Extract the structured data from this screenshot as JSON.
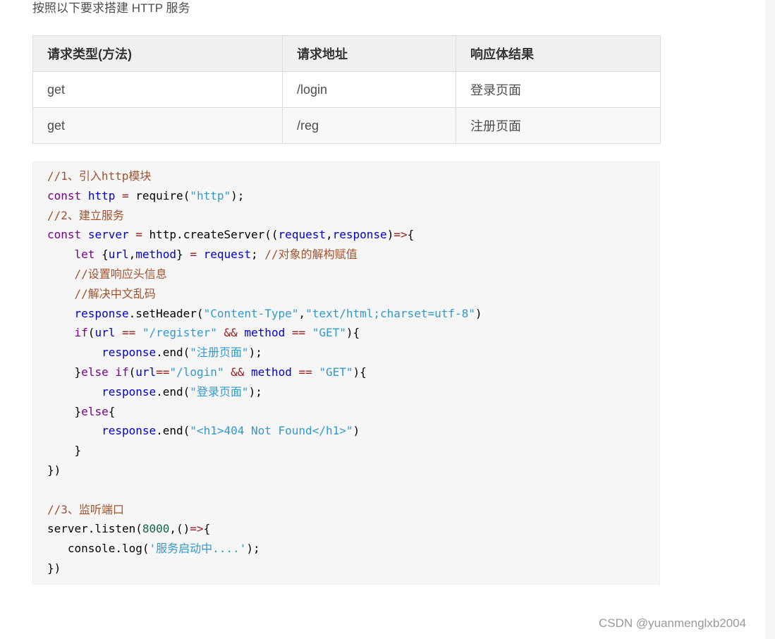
{
  "intro_text": "按照以下要求搭建 HTTP 服务",
  "table": {
    "headers": [
      "请求类型(方法)",
      "请求地址",
      "响应体结果"
    ],
    "rows": [
      [
        "get",
        "/login",
        "登录页面"
      ],
      [
        "get",
        "/reg",
        "注册页面"
      ]
    ]
  },
  "code": {
    "colors": {
      "comment": "#a0522d",
      "keyword": "#770088",
      "string": "#3399cc",
      "number": "#116644",
      "variable": "#0000cc",
      "operator": "#981a1a",
      "plain": "#000000"
    },
    "lines": [
      [
        [
          "comment",
          "//1、引入http模块"
        ]
      ],
      [
        [
          "keyword",
          "const"
        ],
        [
          "plain",
          " "
        ],
        [
          "variable",
          "http"
        ],
        [
          "plain",
          " "
        ],
        [
          "operator",
          "="
        ],
        [
          "plain",
          " require("
        ],
        [
          "string",
          "\"http\""
        ],
        [
          "plain",
          ");"
        ]
      ],
      [
        [
          "comment",
          "//2、建立服务"
        ]
      ],
      [
        [
          "keyword",
          "const"
        ],
        [
          "plain",
          " "
        ],
        [
          "variable",
          "server"
        ],
        [
          "plain",
          " "
        ],
        [
          "operator",
          "="
        ],
        [
          "plain",
          " http.createServer(("
        ],
        [
          "variable",
          "request"
        ],
        [
          "plain",
          ","
        ],
        [
          "variable",
          "response"
        ],
        [
          "plain",
          ")"
        ],
        [
          "operator",
          "=>"
        ],
        [
          "plain",
          "{"
        ]
      ],
      [
        [
          "plain",
          "    "
        ],
        [
          "keyword",
          "let"
        ],
        [
          "plain",
          " {"
        ],
        [
          "variable",
          "url"
        ],
        [
          "plain",
          ","
        ],
        [
          "variable",
          "method"
        ],
        [
          "plain",
          "} "
        ],
        [
          "operator",
          "="
        ],
        [
          "plain",
          " "
        ],
        [
          "variable",
          "request"
        ],
        [
          "plain",
          "; "
        ],
        [
          "comment",
          "//对象的解构赋值"
        ]
      ],
      [
        [
          "plain",
          "    "
        ],
        [
          "comment",
          "//设置响应头信息"
        ]
      ],
      [
        [
          "plain",
          "    "
        ],
        [
          "comment",
          "//解决中文乱码"
        ]
      ],
      [
        [
          "plain",
          "    "
        ],
        [
          "variable",
          "response"
        ],
        [
          "plain",
          ".setHeader("
        ],
        [
          "string",
          "\"Content-Type\""
        ],
        [
          "plain",
          ","
        ],
        [
          "string",
          "\"text/html;charset=utf-8\""
        ],
        [
          "plain",
          ")"
        ]
      ],
      [
        [
          "plain",
          "    "
        ],
        [
          "keyword",
          "if"
        ],
        [
          "plain",
          "("
        ],
        [
          "variable",
          "url"
        ],
        [
          "plain",
          " "
        ],
        [
          "operator",
          "=="
        ],
        [
          "plain",
          " "
        ],
        [
          "string",
          "\"/register\""
        ],
        [
          "plain",
          " "
        ],
        [
          "operator",
          "&&"
        ],
        [
          "plain",
          " "
        ],
        [
          "variable",
          "method"
        ],
        [
          "plain",
          " "
        ],
        [
          "operator",
          "=="
        ],
        [
          "plain",
          " "
        ],
        [
          "string",
          "\"GET\""
        ],
        [
          "plain",
          "){"
        ]
      ],
      [
        [
          "plain",
          "        "
        ],
        [
          "variable",
          "response"
        ],
        [
          "plain",
          ".end("
        ],
        [
          "string",
          "\"注册页面\""
        ],
        [
          "plain",
          ");"
        ]
      ],
      [
        [
          "plain",
          "    }"
        ],
        [
          "keyword",
          "else"
        ],
        [
          "plain",
          " "
        ],
        [
          "keyword",
          "if"
        ],
        [
          "plain",
          "("
        ],
        [
          "variable",
          "url"
        ],
        [
          "operator",
          "=="
        ],
        [
          "string",
          "\"/login\""
        ],
        [
          "plain",
          " "
        ],
        [
          "operator",
          "&&"
        ],
        [
          "plain",
          " "
        ],
        [
          "variable",
          "method"
        ],
        [
          "plain",
          " "
        ],
        [
          "operator",
          "=="
        ],
        [
          "plain",
          " "
        ],
        [
          "string",
          "\"GET\""
        ],
        [
          "plain",
          "){"
        ]
      ],
      [
        [
          "plain",
          "        "
        ],
        [
          "variable",
          "response"
        ],
        [
          "plain",
          ".end("
        ],
        [
          "string",
          "\"登录页面\""
        ],
        [
          "plain",
          ");"
        ]
      ],
      [
        [
          "plain",
          "    }"
        ],
        [
          "keyword",
          "else"
        ],
        [
          "plain",
          "{"
        ]
      ],
      [
        [
          "plain",
          "        "
        ],
        [
          "variable",
          "response"
        ],
        [
          "plain",
          ".end("
        ],
        [
          "string",
          "\"<h1>404 Not Found</h1>\""
        ],
        [
          "plain",
          ")"
        ]
      ],
      [
        [
          "plain",
          "    }"
        ]
      ],
      [
        [
          "plain",
          "})"
        ]
      ],
      [
        [
          "plain",
          ""
        ]
      ],
      [
        [
          "comment",
          "//3、监听端口"
        ]
      ],
      [
        [
          "plain",
          "server.listen("
        ],
        [
          "number",
          "8000"
        ],
        [
          "plain",
          ",()"
        ],
        [
          "operator",
          "=>"
        ],
        [
          "plain",
          "{"
        ]
      ],
      [
        [
          "plain",
          "   console.log("
        ],
        [
          "string",
          "'服务启动中....'"
        ],
        [
          "plain",
          ");"
        ]
      ],
      [
        [
          "plain",
          "})"
        ]
      ]
    ]
  },
  "watermark": "CSDN @yuanmenglxb2004"
}
